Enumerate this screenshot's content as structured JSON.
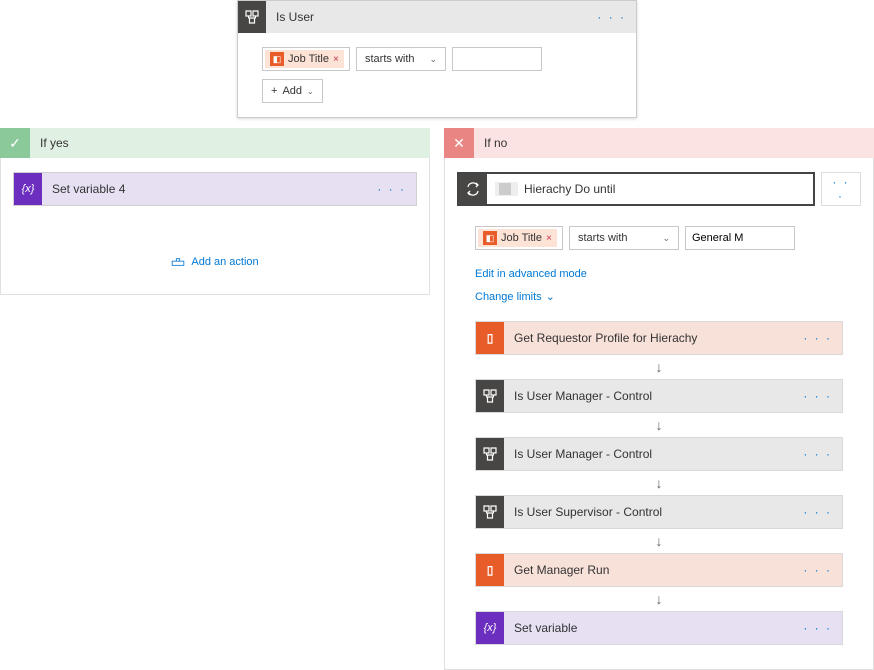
{
  "topCondition": {
    "title": "Is User",
    "jobTitleToken": "Job Title",
    "operator": "starts with",
    "value": "",
    "addBtn": "Add"
  },
  "branches": {
    "yesLabel": "If yes",
    "noLabel": "If no"
  },
  "yesBranch": {
    "action1": "Set variable 4",
    "addAction": "Add an action"
  },
  "noBranch": {
    "doUntilTitle": "Hierachy Do until",
    "cond": {
      "jobTitleToken": "Job Title",
      "operator": "starts with",
      "value": "General M"
    },
    "editAdvanced": "Edit in advanced mode",
    "changeLimits": "Change limits",
    "steps": [
      {
        "title": "Get Requestor Profile for Hierachy",
        "icon": "office",
        "bg": "orange"
      },
      {
        "title": "Is User         Manager - Control",
        "icon": "condition",
        "bg": "gray"
      },
      {
        "title": "Is User Manager - Control",
        "icon": "condition",
        "bg": "gray"
      },
      {
        "title": "Is User Supervisor - Control",
        "icon": "condition",
        "bg": "gray"
      },
      {
        "title": "Get Manager       Run",
        "icon": "office",
        "bg": "orange"
      },
      {
        "title": "Set variable",
        "icon": "variable",
        "bg": "purple"
      }
    ],
    "menuCell": "· · ·"
  }
}
